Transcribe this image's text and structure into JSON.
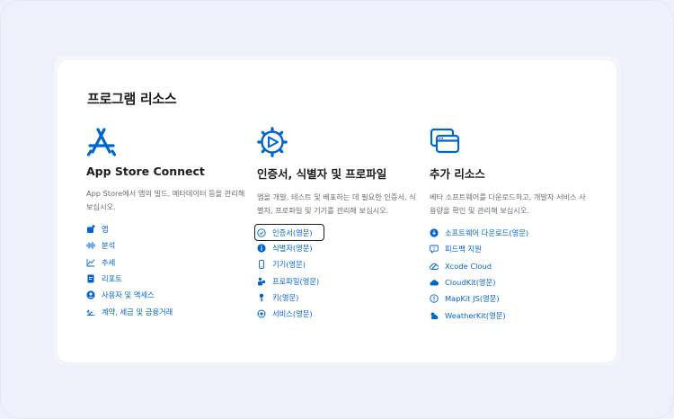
{
  "page": {
    "title": "프로그램 리소스"
  },
  "colors": {
    "accent": "#0066cc",
    "text": "#1d1d1f",
    "muted": "#6e6e73"
  },
  "columns": [
    {
      "icon": "app-store-icon",
      "title": "App Store Connect",
      "description": "App Store에서 앱의 빌드, 메타데이터 등을 관리해 보십시오.",
      "links": [
        {
          "label": "앱",
          "icon": "app-icon"
        },
        {
          "label": "분석",
          "icon": "waveform-icon"
        },
        {
          "label": "추세",
          "icon": "chart-line-icon"
        },
        {
          "label": "리포트",
          "icon": "report-icon"
        },
        {
          "label": "사용자 및 액세스",
          "icon": "user-circle-icon"
        },
        {
          "label": "계약, 세금 및 금융거래",
          "icon": "signature-icon"
        }
      ]
    },
    {
      "icon": "gear-play-icon",
      "title": "인증서, 식별자 및 프로파일",
      "description": "앱을 개발, 테스트 및 배포하는 데 필요한 인증서, 식별자, 프로파일 및 기기를 관리해 보십시오.",
      "links": [
        {
          "label": "인증서(영문)",
          "icon": "badge-check-icon",
          "focused": true
        },
        {
          "label": "식별자(영문)",
          "icon": "info-icon"
        },
        {
          "label": "기기(영문)",
          "icon": "phone-icon"
        },
        {
          "label": "프로파일(영문)",
          "icon": "profile-icon"
        },
        {
          "label": "키(영문)",
          "icon": "key-icon"
        },
        {
          "label": "서비스(영문)",
          "icon": "services-icon"
        }
      ]
    },
    {
      "icon": "windows-icon",
      "title": "추가 리소스",
      "description": "베타 소프트웨어를 다운로드하고, 개발자 서비스 사용량을 확인 및 관리해 보십시오.",
      "links": [
        {
          "label": "소프트웨어 다운로드(영문)",
          "icon": "download-icon"
        },
        {
          "label": "피드백 지원",
          "icon": "feedback-icon"
        },
        {
          "label": "Xcode Cloud",
          "icon": "xcode-cloud-icon"
        },
        {
          "label": "CloudKit(영문)",
          "icon": "cloud-icon"
        },
        {
          "label": "MapKit JS(영문)",
          "icon": "map-icon"
        },
        {
          "label": "WeatherKit(영문)",
          "icon": "weather-icon"
        }
      ]
    }
  ]
}
